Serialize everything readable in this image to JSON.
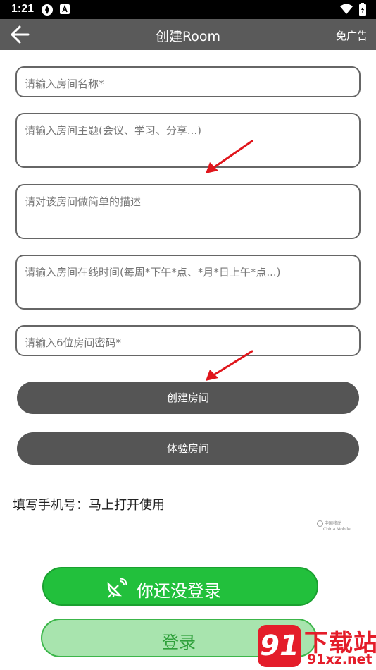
{
  "status": {
    "time": "1:21"
  },
  "appbar": {
    "title": "创建Room",
    "right_action": "免广告"
  },
  "form": {
    "room_name_placeholder": "请输入房间名称*",
    "room_topic_placeholder": "请输入房间主题(会议、学习、分享...)",
    "room_desc_placeholder": "请对该房间做简单的描述",
    "room_time_placeholder": "请输入房间在线时间(每周*下午*点、*月*日上午*点...)",
    "room_password_placeholder": "请输入6位房间密码*"
  },
  "buttons": {
    "create": "创建房间",
    "trial": "体验房间"
  },
  "phone_hint": "填写手机号：马上打开使用",
  "carrier_logo": {
    "line1": "中国移动",
    "line2": "China Mobile"
  },
  "login_banner": {
    "not_logged_in": "你还没登录",
    "login": "登录"
  },
  "watermark": {
    "brand": "下载站",
    "domain": "91xz.net",
    "logo_text": "91"
  },
  "colors": {
    "appbar": "#5a5a5a",
    "button_dark": "#555555",
    "green": "#22c03c",
    "light_green": "#a8e4ae",
    "arrow": "#e0161c"
  }
}
